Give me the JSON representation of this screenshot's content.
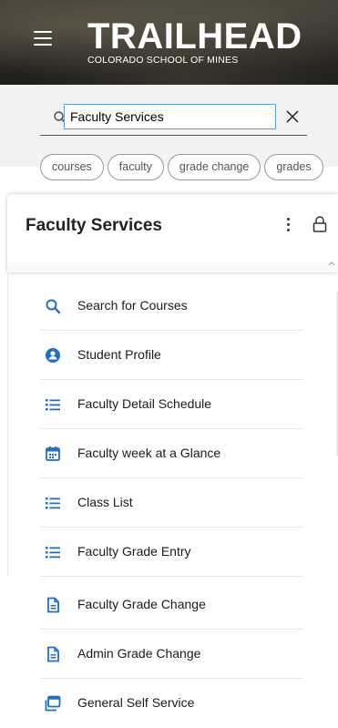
{
  "header": {
    "brand_title": "TRAILHEAD",
    "brand_subtitle": "COLORADO SCHOOL OF MINES",
    "menu_icon": "hamburger-menu-icon"
  },
  "search": {
    "value": "Faculty Services",
    "search_icon": "search-icon",
    "clear_icon": "close-icon"
  },
  "chips": [
    "courses",
    "faculty",
    "grade change",
    "grades"
  ],
  "card": {
    "title": "Faculty Services",
    "more_icon": "vertical-dots-icon",
    "lock_icon": "lock-icon"
  },
  "accent_color": "#1f6fc5",
  "items": [
    {
      "label": "Search for Courses",
      "icon": "search-icon"
    },
    {
      "label": "Student Profile",
      "icon": "user-circle-icon"
    },
    {
      "label": "Faculty Detail Schedule",
      "icon": "list-icon"
    },
    {
      "label": "Faculty week at a Glance",
      "icon": "calendar-icon"
    },
    {
      "label": "Class List",
      "icon": "list-icon"
    },
    {
      "label": "Faculty Grade Entry",
      "icon": "list-icon"
    },
    {
      "label": "Faculty Grade Change",
      "icon": "document-icon"
    },
    {
      "label": "Admin Grade Change",
      "icon": "document-icon"
    },
    {
      "label": "General Self Service",
      "icon": "window-icon"
    }
  ]
}
